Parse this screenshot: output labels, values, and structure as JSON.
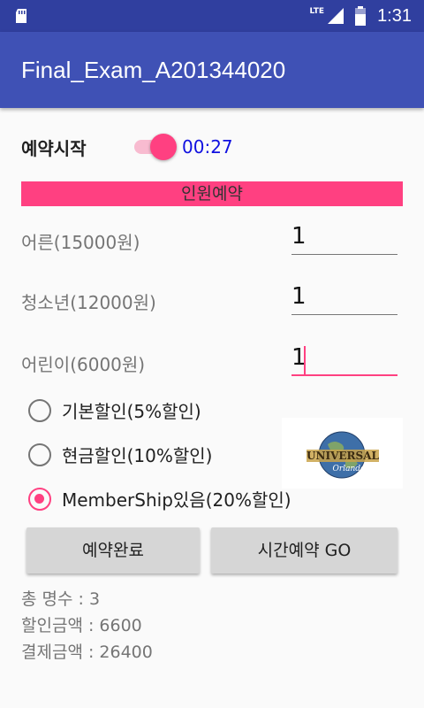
{
  "status_bar": {
    "network": "LTE",
    "time": "1:31",
    "icons": [
      "sd-card-icon",
      "signal-icon",
      "battery-icon"
    ]
  },
  "app_bar": {
    "title": "Final_Exam_A201344020"
  },
  "reservation": {
    "label": "예약시작",
    "switch_on": true,
    "timer": "00:27",
    "section_title": "인원예약"
  },
  "people": [
    {
      "label": "어른(15000원)",
      "value": "1"
    },
    {
      "label": "청소년(12000원)",
      "value": "1"
    },
    {
      "label": "어린이(6000원)",
      "value": "1"
    }
  ],
  "discounts": [
    {
      "label": "기본할인(5%할인)",
      "checked": false
    },
    {
      "label": "현금할인(10%할인)",
      "checked": false
    },
    {
      "label": "MemberShip있음(20%할인)",
      "checked": true
    }
  ],
  "logo": {
    "text1": "UNIVERSAL",
    "text2": "Orlando"
  },
  "buttons": {
    "complete": "예약완료",
    "timed_go": "시간예약 GO"
  },
  "summary": {
    "total_people": "총 명수 : 3",
    "discount_amount": "할인금액 : 6600",
    "payment_amount": "결제금액 : 26400"
  },
  "colors": {
    "primary": "#3f51b5",
    "primary_dark": "#303f9f",
    "accent": "#ff4081",
    "timer": "#1010e0"
  }
}
